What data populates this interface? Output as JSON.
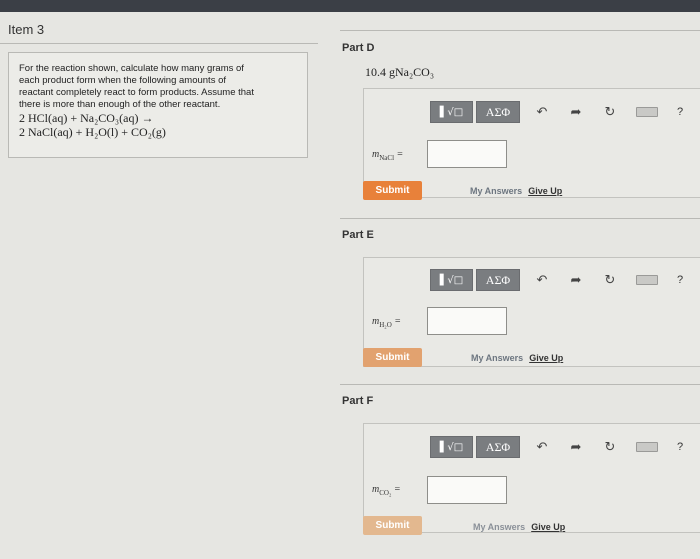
{
  "item": {
    "title": "Item 3"
  },
  "question": {
    "text_lines": [
      "For the reaction shown, calculate how many grams of",
      "each product form when the following amounts of",
      "reactant completely react to form products. Assume that",
      "there is more than enough of the other reactant."
    ],
    "equation_line1": "2 HCl(aq) + Na₂CO₃(aq) →",
    "equation_line2": "2 NaCl(aq) + H₂O(l) + CO₂(g)"
  },
  "toolbar": {
    "root_label": "▌√□",
    "greek_label": "ΑΣΦ",
    "undo_icon": "undo-arrow-icon",
    "redo_icon": "redo-arrow-icon",
    "reset_icon": "reset-icon",
    "keyboard_icon": "keyboard-icon",
    "help_label": "?"
  },
  "parts": [
    {
      "title": "Part D",
      "given": {
        "amount": "10.4 g",
        "formula": "Na₂CO₃"
      },
      "variable": {
        "symbol": "m",
        "subscript": "NaCl"
      },
      "input_value": "",
      "submit_label": "Submit",
      "my_answers": "My Answers",
      "give_up": "Give Up"
    },
    {
      "title": "Part E",
      "variable": {
        "symbol": "m",
        "subscript": "H₂O"
      },
      "input_value": "",
      "submit_label": "Submit",
      "my_answers": "My Answers",
      "give_up": "Give Up"
    },
    {
      "title": "Part F",
      "variable": {
        "symbol": "m",
        "subscript": "CO₂"
      },
      "input_value": "",
      "submit_label": "Submit",
      "my_answers": "My Answers",
      "give_up": "Give Up"
    }
  ],
  "colors": {
    "submit_active": "#e8813a",
    "submit_muted": "#e2a26f",
    "submit_faded": "#e3b88f"
  }
}
